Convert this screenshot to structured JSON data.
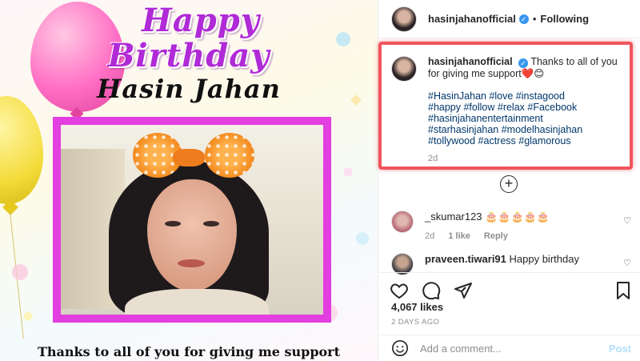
{
  "image": {
    "happy_line1": "Happy",
    "happy_line2": "Birthday",
    "name": "Hasin Jahan",
    "bottom_text": "Thanks to all of you for giving me support"
  },
  "header": {
    "username": "hasinjahanofficial",
    "separator": "•",
    "follow_status": "Following"
  },
  "caption": {
    "username": "hasinjahanofficial",
    "text": "Thanks to all of you for giving me support",
    "emoji": "❤️😊",
    "hashtags_line1": "#HasinJahan #love #instagood",
    "hashtags_line2": "#happy #follow #relax #Facebook",
    "hashtags_line3": "#hasinjahanentertainment",
    "hashtags_line4": "#starhasinjahan #modelhasinjahan",
    "hashtags_line5": "#tollywood #actress #glamorous",
    "age": "2d"
  },
  "load_more": "+",
  "comments": [
    {
      "username": "_skumar123",
      "text": "🎂🎂🎂🎂🎂",
      "age": "2d",
      "likes": "1 like",
      "reply": "Reply"
    },
    {
      "username": "praveen.tiwari91",
      "text": "Happy birthday"
    }
  ],
  "stats": {
    "likes": "4,067 likes",
    "date": "2 DAYS AGO"
  },
  "add_comment": {
    "placeholder": "Add a comment...",
    "post_label": "Post"
  },
  "icons": {
    "verified": "verified-icon",
    "like": "heart-icon",
    "comment": "comment-icon",
    "share": "paper-plane-icon",
    "save": "bookmark-icon",
    "emoji": "emoji-icon"
  },
  "colors": {
    "highlight_box": "#f0555e",
    "link": "#00376b",
    "verified": "#3897f0",
    "title": "#b02ad6",
    "frame": "#e23ee0"
  }
}
